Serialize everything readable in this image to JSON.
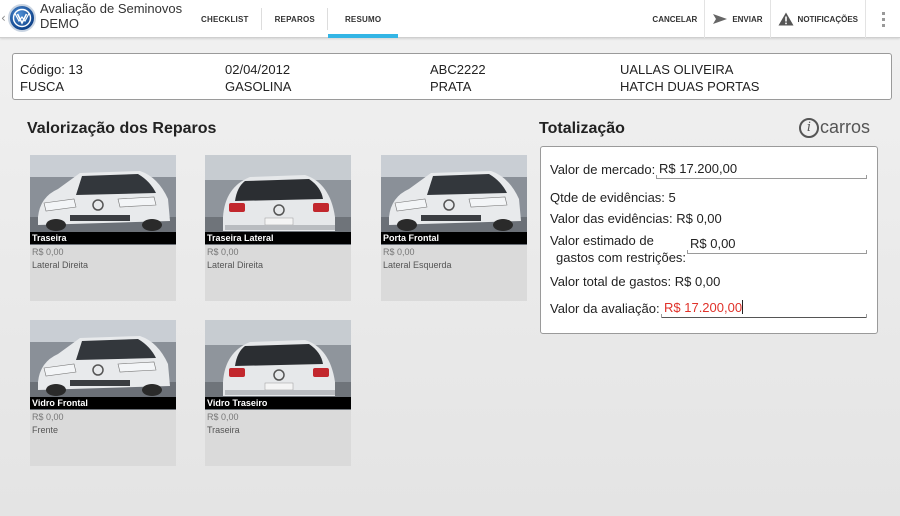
{
  "app": {
    "title_line1": "Avaliação de Seminovos",
    "title_line2": "DEMO"
  },
  "tabs": [
    {
      "label": "CHECKLIST",
      "active": false
    },
    {
      "label": "REPAROS",
      "active": false
    },
    {
      "label": "RESUMO",
      "active": true
    }
  ],
  "actions": {
    "cancel": "CANCELAR",
    "send": "ENVIAR",
    "notifications": "NOTIFICAÇÕES"
  },
  "vehicle": {
    "codigo": "Código: 13",
    "data": "02/04/2012",
    "placa": "ABC2222",
    "cliente": "UALLAS OLIVEIRA",
    "modelo": "FUSCA",
    "combustivel": "GASOLINA",
    "cor": "PRATA",
    "carroceria": "HATCH DUAS PORTAS"
  },
  "reparos": {
    "title": "Valorização dos Reparos",
    "items": [
      {
        "name": "Traseira",
        "price": "R$ 0,00",
        "location": "Lateral Direita",
        "view": "front"
      },
      {
        "name": "Traseira Lateral",
        "price": "R$ 0,00",
        "location": "Lateral Direita",
        "view": "rear"
      },
      {
        "name": "Porta Frontal",
        "price": "R$ 0,00",
        "location": "Lateral Esquerda",
        "view": "front"
      },
      {
        "name": "Vidro Frontal",
        "price": "R$ 0,00",
        "location": "Frente",
        "view": "front"
      },
      {
        "name": "Vidro Traseiro",
        "price": "R$ 0,00",
        "location": "Traseira",
        "view": "rear"
      }
    ]
  },
  "totalizacao": {
    "title": "Totalização",
    "brand": "carros",
    "valor_mercado_label": "Valor de mercado:",
    "valor_mercado": "R$ 17.200,00",
    "qtde_evidencias": "Qtde de evidências:  5",
    "valor_evidencias": "Valor das evidências:  R$ 0,00",
    "valor_estimado_label_1": "Valor estimado de",
    "valor_estimado_label_2": "gastos com restrições:",
    "valor_estimado": "R$ 0,00",
    "valor_total_gastos": "Valor total de gastos:  R$ 0,00",
    "valor_avaliacao_label": "Valor da avaliação:",
    "valor_avaliacao": "R$ 17.200,00"
  },
  "colors": {
    "accent": "#33b5e5",
    "error_text": "#e0322a"
  }
}
